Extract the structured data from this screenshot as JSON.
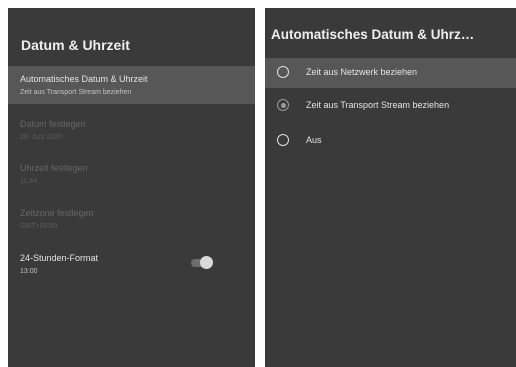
{
  "left": {
    "title": "Datum & Uhrzeit",
    "items": [
      {
        "label": "Automatisches Datum & Uhrzeit",
        "subtitle": "Zeit aus Transport Stream beziehen",
        "selected": true,
        "enabled": true
      },
      {
        "label": "Datum festlegen",
        "subtitle": "29. Juni 2020",
        "selected": false,
        "enabled": false
      },
      {
        "label": "Uhrzeit festlegen",
        "subtitle": "11:44",
        "selected": false,
        "enabled": false
      },
      {
        "label": "Zeitzone festlegen",
        "subtitle": "GMT+03:00",
        "selected": false,
        "enabled": false
      },
      {
        "label": "24-Stunden-Format",
        "subtitle": "13:00",
        "selected": false,
        "enabled": true,
        "toggle_on": true
      }
    ]
  },
  "right": {
    "title": "Automatisches Datum & Uhrz…",
    "options": [
      {
        "label": "Zeit aus Netzwerk beziehen",
        "checked": false,
        "focused": true
      },
      {
        "label": "Zeit aus Transport Stream beziehen",
        "checked": true,
        "focused": false
      },
      {
        "label": "Aus",
        "checked": false,
        "focused": false
      }
    ]
  },
  "colors": {
    "panel_bg": "#3a3a3a",
    "focus_bg": "#575757",
    "text_primary": "#e4e4e4",
    "text_disabled": "#666666"
  }
}
